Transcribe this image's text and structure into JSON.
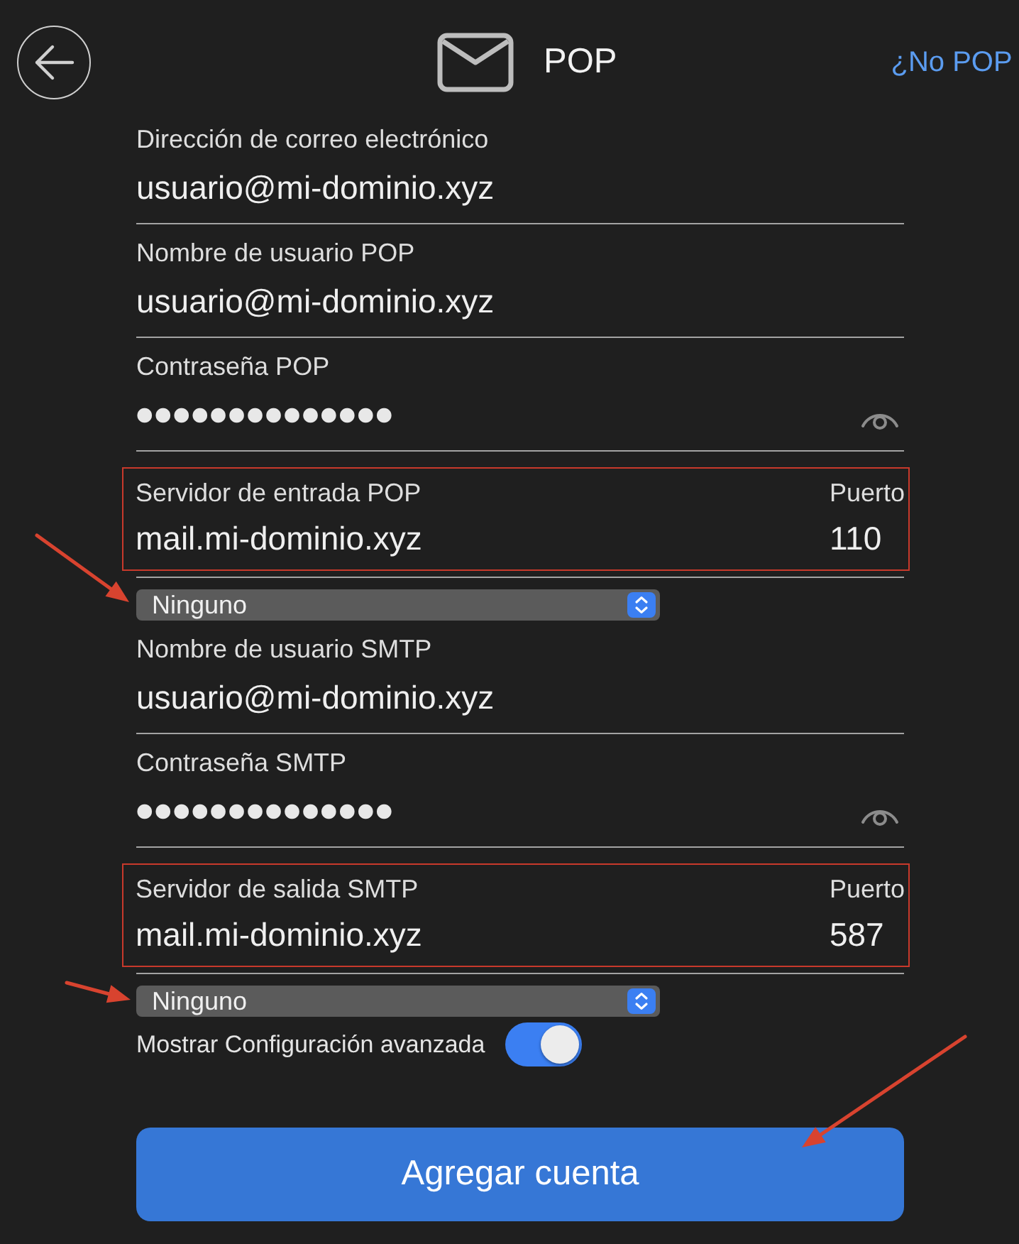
{
  "header": {
    "title": "POP",
    "link": "¿No POP"
  },
  "fields": [
    {
      "kind": "text",
      "label": "Dirección de correo electrónico",
      "value": "usuario@mi-dominio.xyz"
    },
    {
      "kind": "text",
      "label": "Nombre de usuario POP",
      "value": "usuario@mi-dominio.xyz"
    },
    {
      "kind": "password",
      "label": "Contraseña POP",
      "value": "●●●●●●●●●●●●●●"
    },
    {
      "kind": "server",
      "label": "Servidor de entrada POP",
      "value": "mail.mi-dominio.xyz",
      "port_label": "Puerto",
      "port": "110",
      "highlighted": true
    },
    {
      "kind": "select",
      "value": "Ninguno",
      "arrow": true
    },
    {
      "kind": "text",
      "label": "Nombre de usuario SMTP",
      "value": "usuario@mi-dominio.xyz"
    },
    {
      "kind": "password",
      "label": "Contraseña SMTP",
      "value": "●●●●●●●●●●●●●●"
    },
    {
      "kind": "server",
      "label": "Servidor de salida SMTP",
      "value": "mail.mi-dominio.xyz",
      "port_label": "Puerto",
      "port": "587",
      "highlighted": true
    },
    {
      "kind": "select",
      "value": "Ninguno",
      "arrow": true
    }
  ],
  "advanced_toggle": {
    "label": "Mostrar Configuración avanzada",
    "on": true
  },
  "submit_button": {
    "label": "Agregar cuenta",
    "arrow": true
  }
}
